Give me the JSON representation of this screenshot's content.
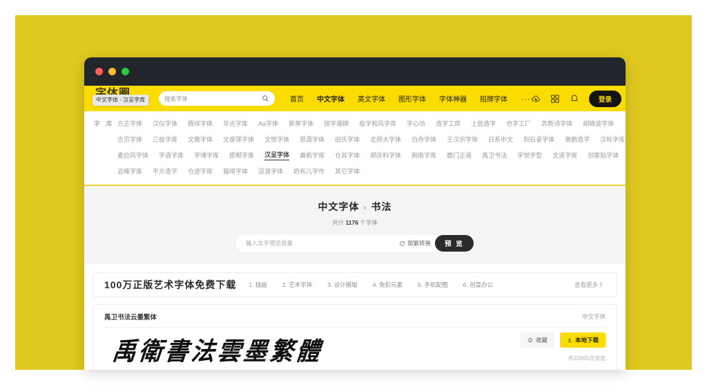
{
  "window": {
    "traffic_lights": [
      "close",
      "minimize",
      "maximize"
    ]
  },
  "header": {
    "logo_text": "字体圈",
    "logo_tooltip": "中文字体 - 汉呈字库",
    "search": {
      "placeholder": "搜索字体",
      "value": "",
      "icon": "search-icon"
    },
    "nav": [
      {
        "label": "首页",
        "active": false
      },
      {
        "label": "中文字体",
        "active": true
      },
      {
        "label": "英文字体",
        "active": false
      },
      {
        "label": "图形字体",
        "active": false
      },
      {
        "label": "字体神器",
        "active": false
      },
      {
        "label": "招牌字体",
        "active": false
      }
    ],
    "more_label": "···",
    "icons": [
      "cloud-upload-icon",
      "apps-grid-icon",
      "notification-bell-icon"
    ],
    "login_label": "登录",
    "accent": "#fbdc00",
    "login_bg": "#141414",
    "login_fg": "#ffd400"
  },
  "categories": {
    "row_label": "字 库",
    "rows": [
      [
        "方正字体",
        "汉仪字体",
        "腾祥字体",
        "华光字库",
        "Aa字体",
        "新蒂字体",
        "锐字潮牌",
        "极字和风字库",
        "字心坊",
        "造字工房",
        "上首造字",
        "也字工厂",
        "苏新诗字体",
        "胡晓波字体"
      ],
      [
        "吉页字体",
        "三极字库",
        "文鼎字体",
        "文泉驿字体",
        "文悦字体",
        "思源字体",
        "田氏字体",
        "北师大字体",
        "白舟字体",
        "王汉宗字体",
        "日系中文",
        "刻石录字体",
        "喜鹊造字",
        "汉标字库"
      ],
      [
        "麦拉风字体",
        "字语字库",
        "字魂字库",
        "邯郸字库",
        "汉呈字体",
        "粪帆字库",
        "仓耳字体",
        "郑庆科字体",
        "荆南字库",
        "鹿门正道",
        "禹卫书法",
        "字悦字型",
        "文道字库",
        "创客贴字体"
      ],
      [
        "云峰字库",
        "平方造字",
        "仓迹字库",
        "猫啃字体",
        "逗浪字体",
        "奶布儿字作",
        "其它字体"
      ]
    ],
    "active_item": "汉呈字体"
  },
  "title_zone": {
    "breadcrumb_parent": "中文字体",
    "breadcrumb_sep": "›",
    "breadcrumb_current": "书法",
    "count_prefix": "共计",
    "count_value": "1176",
    "count_suffix": "个字体",
    "preview": {
      "placeholder": "输入文字预览效果",
      "value": "",
      "convert_label": "简繁转换",
      "convert_icon": "refresh-icon",
      "button_label": "预 览"
    }
  },
  "promo": {
    "title": "100万正版艺术字体免费下载",
    "items": [
      "1. 插画",
      "2. 艺术字体",
      "3. 设计模版",
      "4. 免扣元素",
      "5. 手机配图",
      "6. 创意办公"
    ],
    "more_label": "查看更多 》"
  },
  "font_card": {
    "name": "禹卫书法云墨繁体",
    "tag": "中文字体",
    "sample_text": "禹衛書法雲墨繁體",
    "favorite_label": "收藏",
    "favorite_icon": "star-icon",
    "download_label": "本地下载",
    "download_icon": "download-icon",
    "views_text": "共22865次浏览",
    "download_bg": "#fbdc00"
  },
  "page": {
    "backdrop_color": "#dfc81f"
  }
}
